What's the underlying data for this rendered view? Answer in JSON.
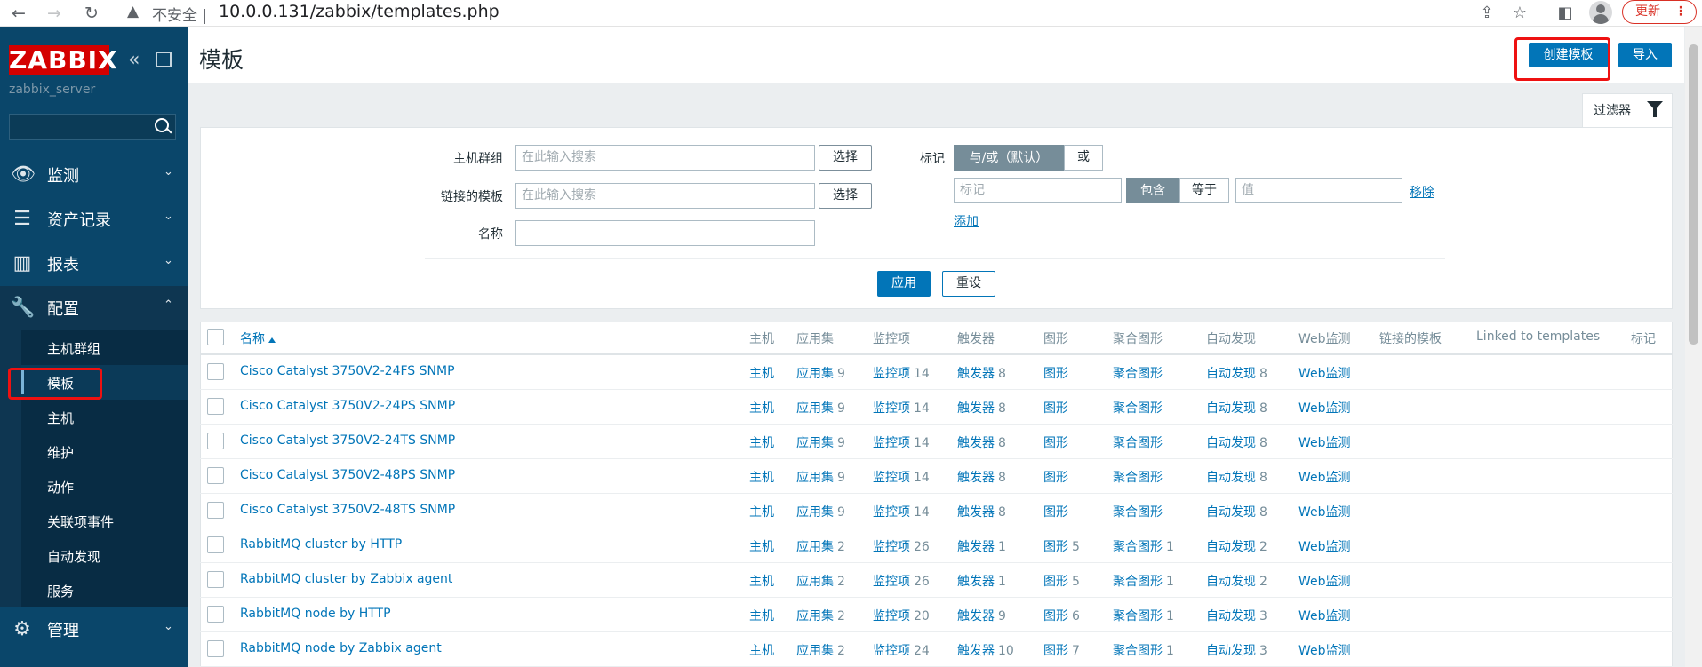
{
  "browser": {
    "insecure_label": "不安全",
    "separator": "|",
    "url": "10.0.0.131/zabbix/templates.php",
    "update_label": "更新",
    "warning_icon": "warning-triangle-icon",
    "back_icon": "←",
    "forward_icon": "→",
    "reload_icon": "↻",
    "share_icon": "⇪",
    "star_icon": "☆",
    "sidebar_icon": "◧"
  },
  "sidebar": {
    "logo": "ZABBIX",
    "server_name": "zabbix_server",
    "collapse_icon": "«",
    "menu": [
      {
        "label": "监测",
        "icon": "👁",
        "arrow": "⌄"
      },
      {
        "label": "资产记录",
        "icon": "☰",
        "arrow": "⌄"
      },
      {
        "label": "报表",
        "icon": "▥",
        "arrow": "⌄"
      },
      {
        "label": "配置",
        "icon": "🔧",
        "arrow": "⌃"
      }
    ],
    "submenu": [
      "主机群组",
      "模板",
      "主机",
      "维护",
      "动作",
      "关联项事件",
      "自动发现",
      "服务"
    ],
    "admin": {
      "label": "管理",
      "icon": "⚙",
      "arrow": "⌄"
    }
  },
  "header": {
    "title": "模板",
    "create_button": "创建模板",
    "import_button": "导入"
  },
  "filter": {
    "tab_label": "过滤器",
    "host_groups_label": "主机群组",
    "linked_templates_label": "链接的模板",
    "name_label": "名称",
    "search_placeholder": "在此输入搜索",
    "select_button": "选择",
    "tags_label": "标记",
    "and_or": "与/或（默认）",
    "or": "或",
    "tag_placeholder": "标记",
    "contains": "包含",
    "equals": "等于",
    "value_placeholder": "值",
    "remove": "移除",
    "add": "添加",
    "apply": "应用",
    "reset": "重设"
  },
  "table": {
    "headers": {
      "name": "名称",
      "hosts": "主机",
      "applications": "应用集",
      "items": "监控项",
      "triggers": "触发器",
      "graphs": "图形",
      "screens": "聚合图形",
      "discovery": "自动发现",
      "web": "Web监测",
      "linked_templates": "链接的模板",
      "linked_to_templates": "Linked to templates",
      "tags": "标记"
    },
    "rows": [
      {
        "name": "Cisco Catalyst 3750V2-24FS SNMP",
        "hosts": "主机",
        "app": "应用集",
        "app_n": "9",
        "items": "监控项",
        "items_n": "14",
        "trig": "触发器",
        "trig_n": "8",
        "graphs": "图形",
        "graphs_n": "",
        "screens": "聚合图形",
        "screens_n": "",
        "disc": "自动发现",
        "disc_n": "8",
        "web": "Web监测"
      },
      {
        "name": "Cisco Catalyst 3750V2-24PS SNMP",
        "hosts": "主机",
        "app": "应用集",
        "app_n": "9",
        "items": "监控项",
        "items_n": "14",
        "trig": "触发器",
        "trig_n": "8",
        "graphs": "图形",
        "graphs_n": "",
        "screens": "聚合图形",
        "screens_n": "",
        "disc": "自动发现",
        "disc_n": "8",
        "web": "Web监测"
      },
      {
        "name": "Cisco Catalyst 3750V2-24TS SNMP",
        "hosts": "主机",
        "app": "应用集",
        "app_n": "9",
        "items": "监控项",
        "items_n": "14",
        "trig": "触发器",
        "trig_n": "8",
        "graphs": "图形",
        "graphs_n": "",
        "screens": "聚合图形",
        "screens_n": "",
        "disc": "自动发现",
        "disc_n": "8",
        "web": "Web监测"
      },
      {
        "name": "Cisco Catalyst 3750V2-48PS SNMP",
        "hosts": "主机",
        "app": "应用集",
        "app_n": "9",
        "items": "监控项",
        "items_n": "14",
        "trig": "触发器",
        "trig_n": "8",
        "graphs": "图形",
        "graphs_n": "",
        "screens": "聚合图形",
        "screens_n": "",
        "disc": "自动发现",
        "disc_n": "8",
        "web": "Web监测"
      },
      {
        "name": "Cisco Catalyst 3750V2-48TS SNMP",
        "hosts": "主机",
        "app": "应用集",
        "app_n": "9",
        "items": "监控项",
        "items_n": "14",
        "trig": "触发器",
        "trig_n": "8",
        "graphs": "图形",
        "graphs_n": "",
        "screens": "聚合图形",
        "screens_n": "",
        "disc": "自动发现",
        "disc_n": "8",
        "web": "Web监测"
      },
      {
        "name": "RabbitMQ cluster by HTTP",
        "hosts": "主机",
        "app": "应用集",
        "app_n": "2",
        "items": "监控项",
        "items_n": "26",
        "trig": "触发器",
        "trig_n": "1",
        "graphs": "图形",
        "graphs_n": "5",
        "screens": "聚合图形",
        "screens_n": "1",
        "disc": "自动发现",
        "disc_n": "2",
        "web": "Web监测"
      },
      {
        "name": "RabbitMQ cluster by Zabbix agent",
        "hosts": "主机",
        "app": "应用集",
        "app_n": "2",
        "items": "监控项",
        "items_n": "26",
        "trig": "触发器",
        "trig_n": "1",
        "graphs": "图形",
        "graphs_n": "5",
        "screens": "聚合图形",
        "screens_n": "1",
        "disc": "自动发现",
        "disc_n": "2",
        "web": "Web监测"
      },
      {
        "name": "RabbitMQ node by HTTP",
        "hosts": "主机",
        "app": "应用集",
        "app_n": "2",
        "items": "监控项",
        "items_n": "20",
        "trig": "触发器",
        "trig_n": "9",
        "graphs": "图形",
        "graphs_n": "6",
        "screens": "聚合图形",
        "screens_n": "1",
        "disc": "自动发现",
        "disc_n": "3",
        "web": "Web监测"
      },
      {
        "name": "RabbitMQ node by Zabbix agent",
        "hosts": "主机",
        "app": "应用集",
        "app_n": "2",
        "items": "监控项",
        "items_n": "24",
        "trig": "触发器",
        "trig_n": "10",
        "graphs": "图形",
        "graphs_n": "7",
        "screens": "聚合图形",
        "screens_n": "1",
        "disc": "自动发现",
        "disc_n": "3",
        "web": "Web监测"
      }
    ]
  },
  "colors": {
    "sidebar_bg": "#0a466a",
    "accent": "#0275b8",
    "logo_red": "#d40000",
    "highlight_red": "#e11111"
  }
}
